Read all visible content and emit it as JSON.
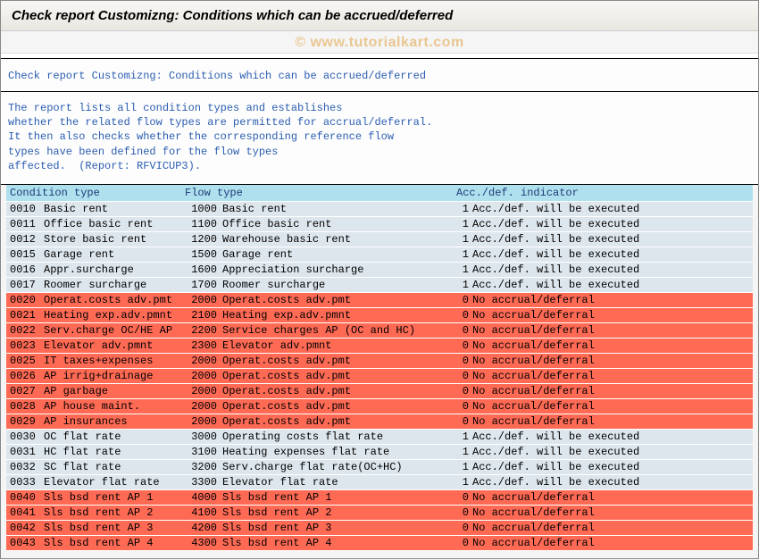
{
  "title": "Check report Customizng: Conditions which can be accrued/deferred",
  "watermark": "© www.tutorialkart.com",
  "subtitle": "Check report Customizng: Conditions which can be accrued/deferred",
  "description": "The report lists all condition types and establishes\nwhether the related flow types are permitted for accrual/deferral.\nIt then also checks whether the corresponding reference flow\ntypes have been defined for the flow types\naffected.  (Report: RFVICUP3).",
  "headers": {
    "cond": "Condition type",
    "flow": "Flow type",
    "ind": "Acc./def. indicator"
  },
  "rows": [
    {
      "style": "blue",
      "cond_code": "0010",
      "cond_text": "Basic rent",
      "flow_code": "1000",
      "flow_text": "Basic rent",
      "ind_code": "1",
      "ind_text": "Acc./def. will be executed"
    },
    {
      "style": "blue",
      "cond_code": "0011",
      "cond_text": "Office basic rent",
      "flow_code": "1100",
      "flow_text": "Office basic rent",
      "ind_code": "1",
      "ind_text": "Acc./def. will be executed"
    },
    {
      "style": "blue",
      "cond_code": "0012",
      "cond_text": "Store basic rent",
      "flow_code": "1200",
      "flow_text": "Warehouse basic rent",
      "ind_code": "1",
      "ind_text": "Acc./def. will be executed"
    },
    {
      "style": "blue",
      "cond_code": "0015",
      "cond_text": "Garage rent",
      "flow_code": "1500",
      "flow_text": "Garage rent",
      "ind_code": "1",
      "ind_text": "Acc./def. will be executed"
    },
    {
      "style": "blue",
      "cond_code": "0016",
      "cond_text": "Appr.surcharge",
      "flow_code": "1600",
      "flow_text": "Appreciation surcharge",
      "ind_code": "1",
      "ind_text": "Acc./def. will be executed"
    },
    {
      "style": "blue",
      "cond_code": "0017",
      "cond_text": "Roomer surcharge",
      "flow_code": "1700",
      "flow_text": "Roomer surcharge",
      "ind_code": "1",
      "ind_text": "Acc./def. will be executed"
    },
    {
      "style": "red",
      "cond_code": "0020",
      "cond_text": "Operat.costs adv.pmt",
      "flow_code": "2000",
      "flow_text": "Operat.costs adv.pmt",
      "ind_code": "0",
      "ind_text": "No accrual/deferral"
    },
    {
      "style": "red",
      "cond_code": "0021",
      "cond_text": "Heating exp.adv.pmnt",
      "flow_code": "2100",
      "flow_text": "Heating exp.adv.pmnt",
      "ind_code": "0",
      "ind_text": "No accrual/deferral"
    },
    {
      "style": "red",
      "cond_code": "0022",
      "cond_text": "Serv.charge OC/HE AP",
      "flow_code": "2200",
      "flow_text": "Service charges AP (OC and HC)",
      "ind_code": "0",
      "ind_text": "No accrual/deferral"
    },
    {
      "style": "red",
      "cond_code": "0023",
      "cond_text": "Elevator adv.pmnt",
      "flow_code": "2300",
      "flow_text": "Elevator adv.pmnt",
      "ind_code": "0",
      "ind_text": "No accrual/deferral"
    },
    {
      "style": "red",
      "cond_code": "0025",
      "cond_text": "IT taxes+expenses",
      "flow_code": "2000",
      "flow_text": "Operat.costs adv.pmt",
      "ind_code": "0",
      "ind_text": "No accrual/deferral"
    },
    {
      "style": "red",
      "cond_code": "0026",
      "cond_text": "AP irrig+drainage",
      "flow_code": "2000",
      "flow_text": "Operat.costs adv.pmt",
      "ind_code": "0",
      "ind_text": "No accrual/deferral"
    },
    {
      "style": "red",
      "cond_code": "0027",
      "cond_text": "AP garbage",
      "flow_code": "2000",
      "flow_text": "Operat.costs adv.pmt",
      "ind_code": "0",
      "ind_text": "No accrual/deferral"
    },
    {
      "style": "red",
      "cond_code": "0028",
      "cond_text": "AP house maint.",
      "flow_code": "2000",
      "flow_text": "Operat.costs adv.pmt",
      "ind_code": "0",
      "ind_text": "No accrual/deferral"
    },
    {
      "style": "red",
      "cond_code": "0029",
      "cond_text": "AP insurances",
      "flow_code": "2000",
      "flow_text": "Operat.costs adv.pmt",
      "ind_code": "0",
      "ind_text": "No accrual/deferral"
    },
    {
      "style": "blue",
      "cond_code": "0030",
      "cond_text": "OC flat rate",
      "flow_code": "3000",
      "flow_text": "Operating costs flat rate",
      "ind_code": "1",
      "ind_text": "Acc./def. will be executed"
    },
    {
      "style": "blue",
      "cond_code": "0031",
      "cond_text": "HC flat rate",
      "flow_code": "3100",
      "flow_text": "Heating expenses flat rate",
      "ind_code": "1",
      "ind_text": "Acc./def. will be executed"
    },
    {
      "style": "blue",
      "cond_code": "0032",
      "cond_text": "SC flat rate",
      "flow_code": "3200",
      "flow_text": "Serv.charge flat rate(OC+HC)",
      "ind_code": "1",
      "ind_text": "Acc./def. will be executed"
    },
    {
      "style": "blue",
      "cond_code": "0033",
      "cond_text": "Elevator flat rate",
      "flow_code": "3300",
      "flow_text": "Elevator flat rate",
      "ind_code": "1",
      "ind_text": "Acc./def. will be executed"
    },
    {
      "style": "red",
      "cond_code": "0040",
      "cond_text": "Sls bsd rent AP 1",
      "flow_code": "4000",
      "flow_text": "Sls bsd rent AP 1",
      "ind_code": "0",
      "ind_text": "No accrual/deferral"
    },
    {
      "style": "red",
      "cond_code": "0041",
      "cond_text": "Sls bsd rent AP 2",
      "flow_code": "4100",
      "flow_text": "Sls bsd rent AP  2",
      "ind_code": "0",
      "ind_text": "No accrual/deferral"
    },
    {
      "style": "red",
      "cond_code": "0042",
      "cond_text": "Sls bsd rent AP 3",
      "flow_code": "4200",
      "flow_text": "Sls bsd rent AP 3",
      "ind_code": "0",
      "ind_text": "No accrual/deferral"
    },
    {
      "style": "red",
      "cond_code": "0043",
      "cond_text": "Sls bsd rent AP 4",
      "flow_code": "4300",
      "flow_text": "Sls bsd rent AP 4",
      "ind_code": "0",
      "ind_text": "No accrual/deferral"
    }
  ]
}
